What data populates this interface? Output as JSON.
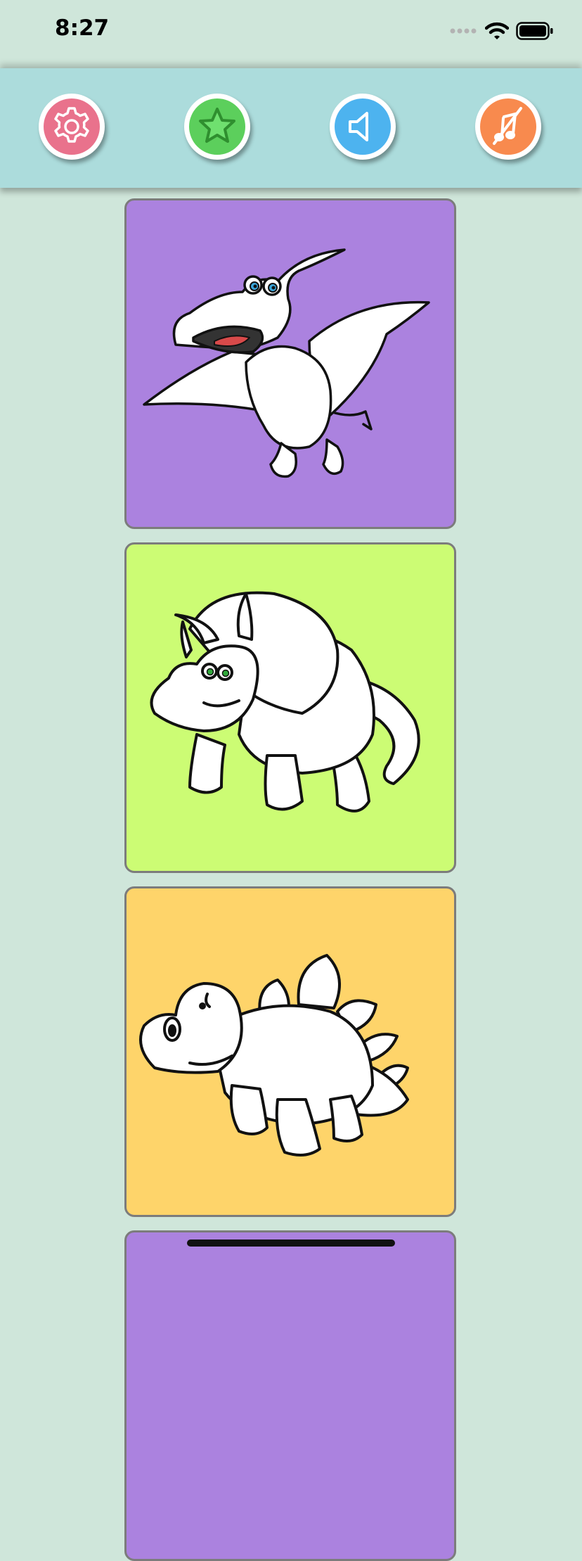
{
  "status_bar": {
    "time": "8:27"
  },
  "toolbar": {
    "buttons": [
      {
        "name": "settings",
        "icon": "gear-icon",
        "color": "#e9728c"
      },
      {
        "name": "favorites",
        "icon": "star-icon",
        "color": "#5ccf5c"
      },
      {
        "name": "sound",
        "icon": "speaker-icon",
        "color": "#4db3ef"
      },
      {
        "name": "music",
        "icon": "music-off-icon",
        "color": "#f88a4e"
      }
    ]
  },
  "gallery": {
    "cards": [
      {
        "subject": "pterodactyl",
        "background": "#ab82df"
      },
      {
        "subject": "triceratops",
        "background": "#ccfc74"
      },
      {
        "subject": "stegosaurus",
        "background": "#fed46a"
      },
      {
        "subject": "partial",
        "background": "#ab82df"
      }
    ]
  },
  "colors": {
    "page_background": "#cfe6da",
    "toolbar_background": "#acdcdc",
    "card_border": "#7c7c7c"
  }
}
